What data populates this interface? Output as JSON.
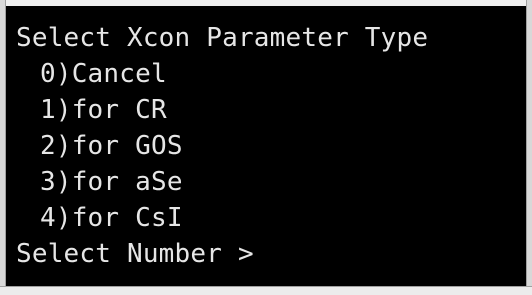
{
  "console": {
    "heading": "Select Xcon Parameter Type",
    "options": [
      "0)Cancel",
      "1)for CR",
      "2)for GOS",
      "3)for aSe",
      "4)for CsI"
    ],
    "prompt": "Select Number >"
  },
  "colors": {
    "background": "#000000",
    "text": "#e6e6e6"
  }
}
